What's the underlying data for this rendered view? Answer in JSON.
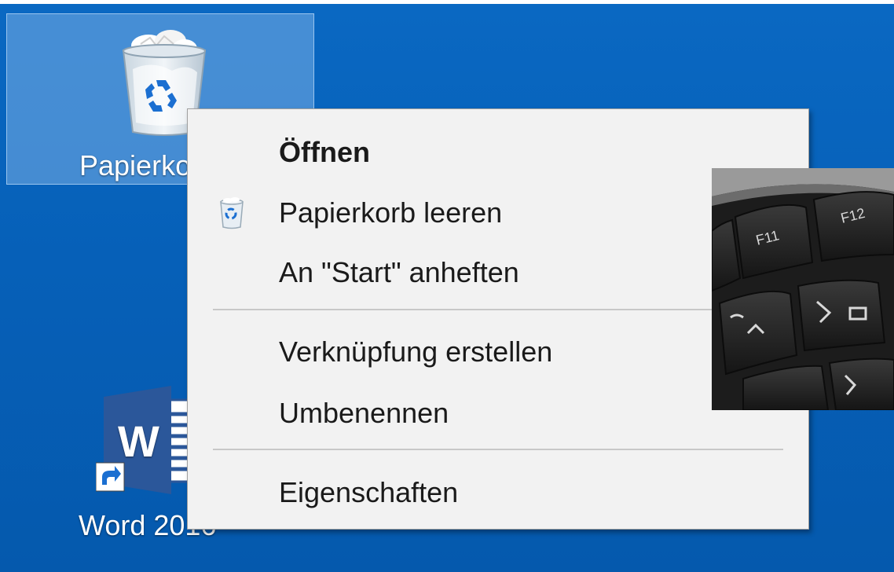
{
  "desktop": {
    "background_color": "#0660b8",
    "icons": [
      {
        "name": "recycle-bin",
        "label": "Papierkorb",
        "icon": "recycle-bin-icon",
        "selected": true
      },
      {
        "name": "word",
        "label": "Word 2016",
        "icon": "word-icon",
        "has_shortcut_arrow": true
      }
    ]
  },
  "context_menu": {
    "items": [
      {
        "label": "Öffnen",
        "bold": true
      },
      {
        "label": "Papierkorb leeren",
        "icon": "recycle-bin-icon"
      },
      {
        "label": "An \"Start\" anheften"
      },
      {
        "label": "Verknüpfung erstellen"
      },
      {
        "label": "Umbenennen"
      },
      {
        "label": "Eigenschaften"
      }
    ]
  },
  "overlay_photo": {
    "description_icon": "keyboard-photo",
    "key_labels": [
      "F11",
      "F12"
    ]
  }
}
